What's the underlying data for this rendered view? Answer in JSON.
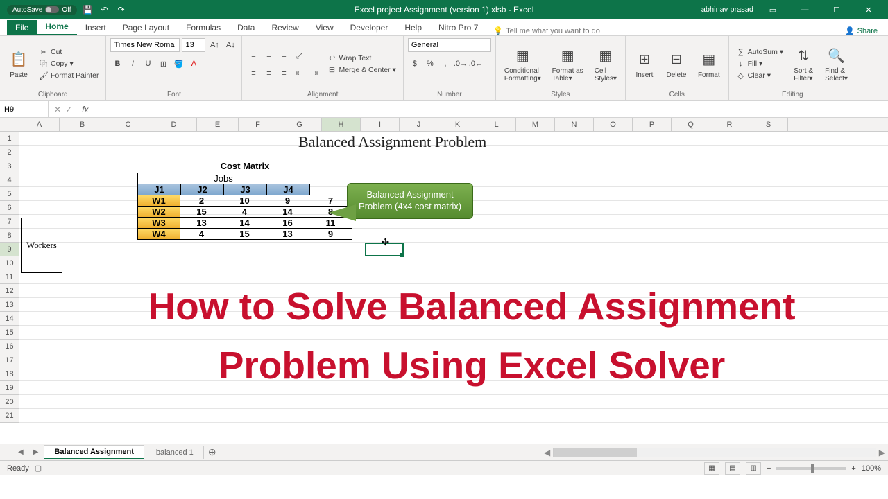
{
  "titlebar": {
    "autosave": "AutoSave",
    "autosave_state": "Off",
    "document_title": "Excel project Assignment (version 1).xlsb - Excel",
    "user": "abhinav prasad"
  },
  "tabs": [
    "File",
    "Home",
    "Insert",
    "Page Layout",
    "Formulas",
    "Data",
    "Review",
    "View",
    "Developer",
    "Help",
    "Nitro Pro 7"
  ],
  "tellme": "Tell me what you want to do",
  "share": "Share",
  "ribbon": {
    "clipboard": {
      "paste": "Paste",
      "cut": "Cut",
      "copy": "Copy",
      "fpainter": "Format Painter",
      "label": "Clipboard"
    },
    "font": {
      "name": "Times New Roma",
      "size": "13",
      "label": "Font"
    },
    "alignment": {
      "wrap": "Wrap Text",
      "merge": "Merge & Center",
      "label": "Alignment"
    },
    "number": {
      "format": "General",
      "label": "Number"
    },
    "styles": {
      "cond": "Conditional Formatting",
      "fat": "Format as Table",
      "cstyles": "Cell Styles",
      "label": "Styles"
    },
    "cells": {
      "insert": "Insert",
      "delete": "Delete",
      "format": "Format",
      "label": "Cells"
    },
    "editing": {
      "autosum": "AutoSum",
      "fill": "Fill",
      "clear": "Clear",
      "sort": "Sort & Filter",
      "find": "Find & Select",
      "label": "Editing"
    }
  },
  "namebox": "H9",
  "columns": [
    "A",
    "B",
    "C",
    "D",
    "E",
    "F",
    "G",
    "H",
    "I",
    "J",
    "K",
    "L",
    "M",
    "N",
    "O",
    "P",
    "Q",
    "R",
    "S"
  ],
  "rows_count": 21,
  "sheet": {
    "title": "Balanced Assignment Problem",
    "cost_matrix_label": "Cost Matrix",
    "jobs_label": "Jobs",
    "workers_label": "Workers",
    "job_headers": [
      "J1",
      "J2",
      "J3",
      "J4"
    ],
    "worker_headers": [
      "W1",
      "W2",
      "W3",
      "W4"
    ],
    "matrix": [
      [
        2,
        10,
        9,
        7
      ],
      [
        15,
        4,
        14,
        8
      ],
      [
        13,
        14,
        16,
        11
      ],
      [
        4,
        15,
        13,
        9
      ]
    ],
    "callout_line1": "Balanced Assignment",
    "callout_line2": "Problem (4x4 cost matrix)"
  },
  "overlay": {
    "line1": "How to Solve Balanced Assignment",
    "line2": "Problem Using Excel Solver"
  },
  "sheets": {
    "tab1": "Balanced Assignment",
    "tab2": "balanced 1"
  },
  "status": {
    "ready": "Ready",
    "zoom": "100%"
  }
}
